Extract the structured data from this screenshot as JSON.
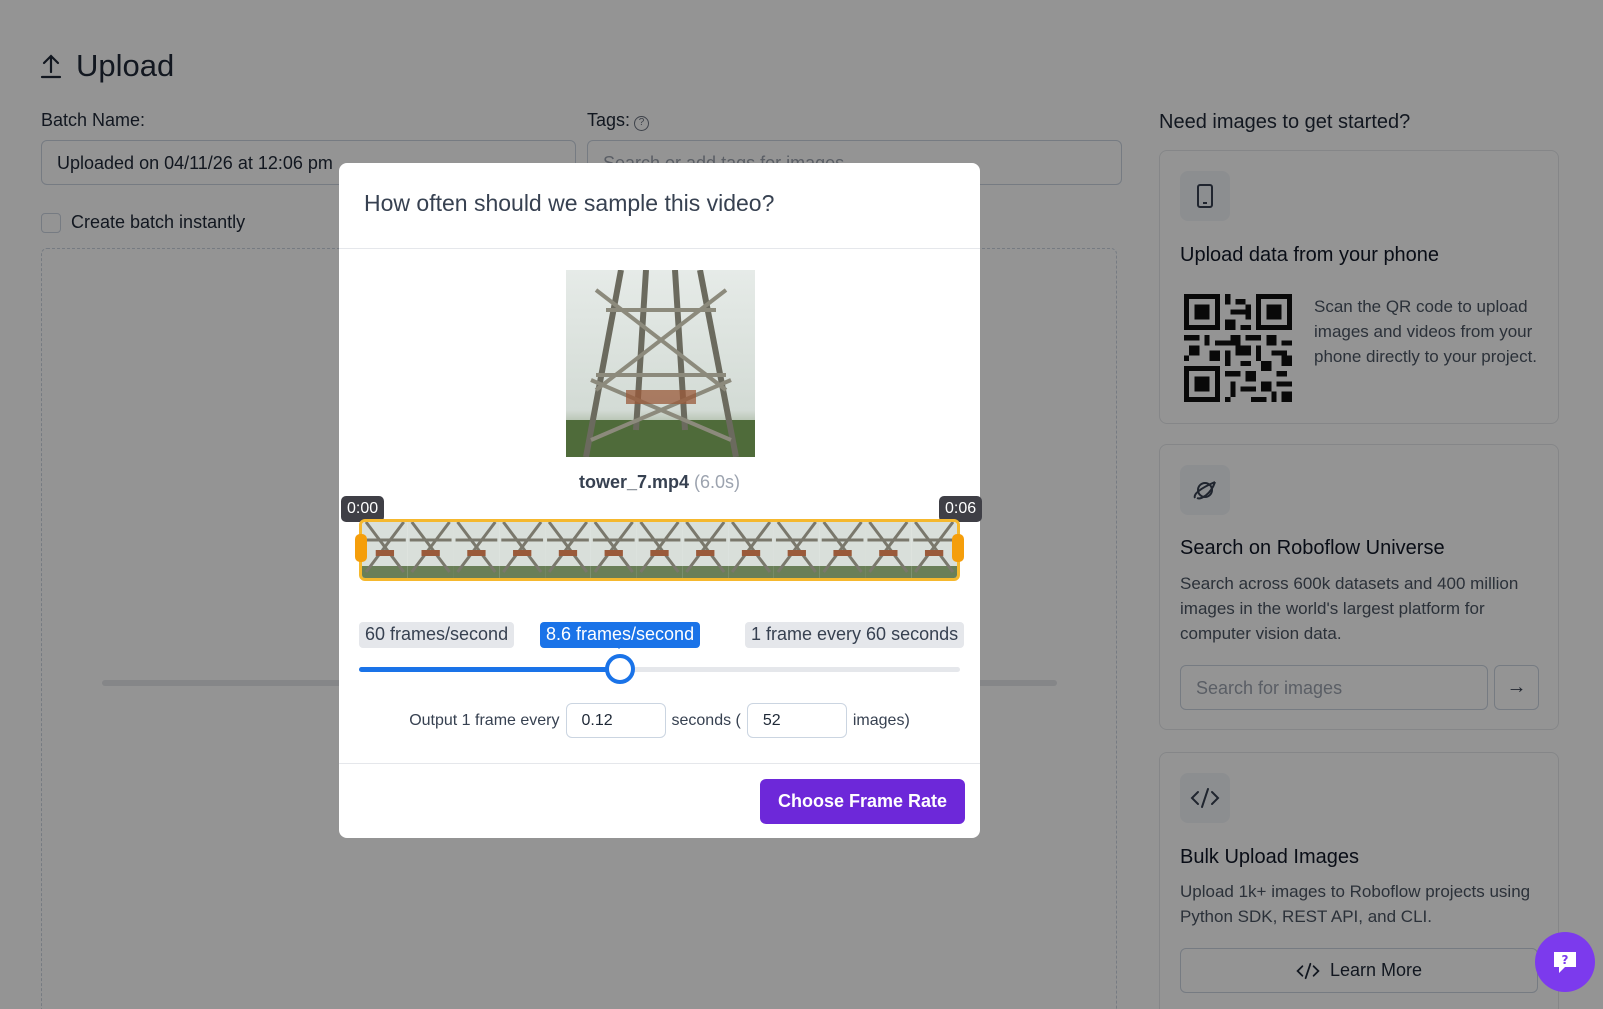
{
  "page": {
    "title": "Upload",
    "batch_label": "Batch Name:",
    "batch_value": "Uploaded on 04/11/26 at 12:06 pm",
    "tags_label": "Tags:",
    "tags_placeholder": "Search or add tags for images",
    "create_batch_label": "Create batch instantly"
  },
  "sidebar": {
    "heading": "Need images to get started?",
    "phone_card": {
      "title": "Upload data from your phone",
      "text": "Scan the QR code to upload images and videos from your phone directly to your project."
    },
    "universe_card": {
      "title": "Search on Roboflow Universe",
      "text": "Search across 600k datasets and 400 million images in the world's largest platform for computer vision data.",
      "search_placeholder": "Search for images"
    },
    "bulk_card": {
      "title": "Bulk Upload Images",
      "text": "Upload 1k+ images to Roboflow projects using Python SDK, REST API, and CLI.",
      "button_label": "Learn More"
    }
  },
  "modal": {
    "title": "How often should we sample this video?",
    "file_name": "tower_7.mp4",
    "duration": "(6.0s)",
    "start_time": "0:00",
    "end_time": "0:06",
    "rate_min_label": "60 frames/second",
    "rate_current_label": "8.6 frames/second",
    "rate_max_label": "1 frame every 60 seconds",
    "slider_fraction": 0.435,
    "output_prefix": "Output 1 frame every",
    "seconds_value": "0.12",
    "seconds_mid": "seconds (",
    "images_value": "52",
    "images_suffix": "images)",
    "confirm_label": "Choose Frame Rate"
  },
  "colors": {
    "accent": "#6d28d9",
    "slider": "#1a73e8",
    "trim": "#f5b82e"
  }
}
